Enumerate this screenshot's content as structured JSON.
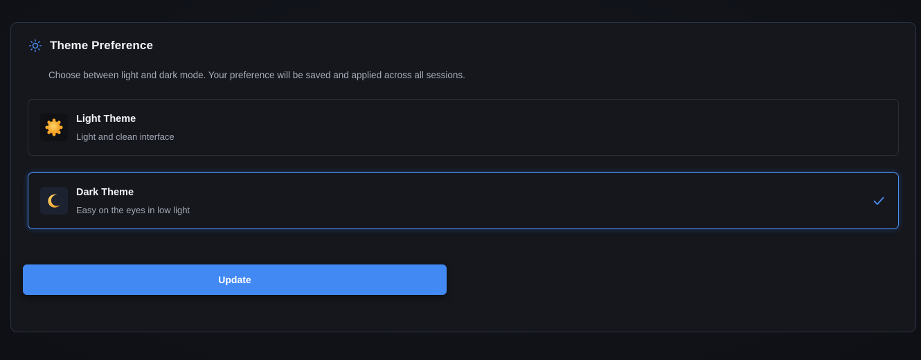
{
  "section": {
    "title": "Theme Preference",
    "description": "Choose between light and dark mode. Your preference will be saved and applied across all sessions.",
    "icon": "sun-outline-icon"
  },
  "options": [
    {
      "title": "Light Theme",
      "subtitle": "Light and clean interface",
      "icon": "sun-icon",
      "selected": false
    },
    {
      "title": "Dark Theme",
      "subtitle": "Easy on the eyes in low light",
      "icon": "moon-icon",
      "selected": true
    }
  ],
  "actions": {
    "update_label": "Update"
  },
  "colors": {
    "accent": "#4289f4",
    "background": "#111319",
    "card": "#15171d",
    "border": "#2a3344",
    "text_primary": "#f3f4f6",
    "text_secondary": "#a7adb8"
  }
}
